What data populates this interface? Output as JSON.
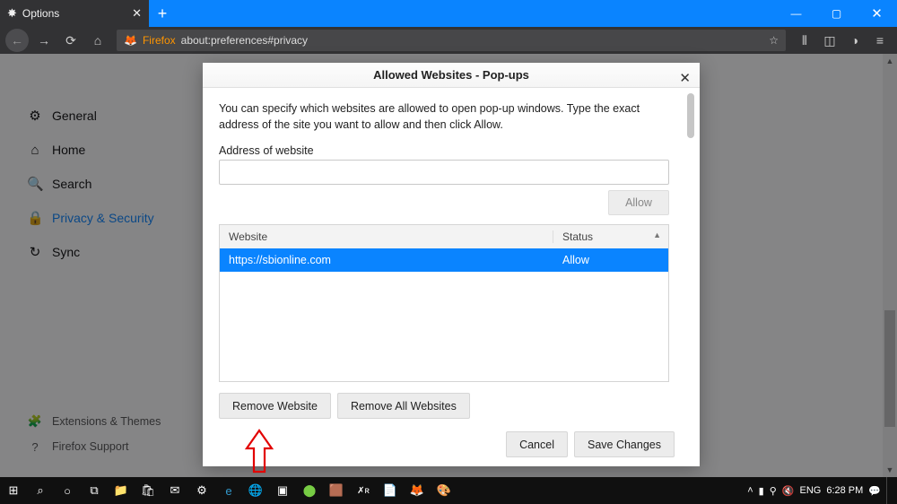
{
  "titlebar": {
    "tab": "Options"
  },
  "urlbar": {
    "prefix": "Firefox",
    "url": "about:preferences#privacy"
  },
  "sidebar": {
    "items": [
      {
        "icon": "⚙",
        "label": "General"
      },
      {
        "icon": "⌂",
        "label": "Home"
      },
      {
        "icon": "🔍",
        "label": "Search"
      },
      {
        "icon": "🔒",
        "label": "Privacy & Security"
      },
      {
        "icon": "↻",
        "label": "Sync"
      }
    ],
    "footer": [
      {
        "icon": "🧩",
        "label": "Extensions & Themes"
      },
      {
        "icon": "?",
        "label": "Firefox Support"
      }
    ]
  },
  "modal": {
    "title": "Allowed Websites - Pop-ups",
    "description": "You can specify which websites are allowed to open pop-up windows. Type the exact address of the site you want to allow and then click Allow.",
    "addressLabel": "Address of website",
    "allowBtn": "Allow",
    "columns": {
      "website": "Website",
      "status": "Status"
    },
    "rows": [
      {
        "website": "https://sbionline.com",
        "status": "Allow"
      }
    ],
    "removeWebsite": "Remove Website",
    "removeAll": "Remove All Websites",
    "cancel": "Cancel",
    "save": "Save Changes"
  },
  "taskbar": {
    "lang": "ENG",
    "time": "6:28 PM"
  }
}
